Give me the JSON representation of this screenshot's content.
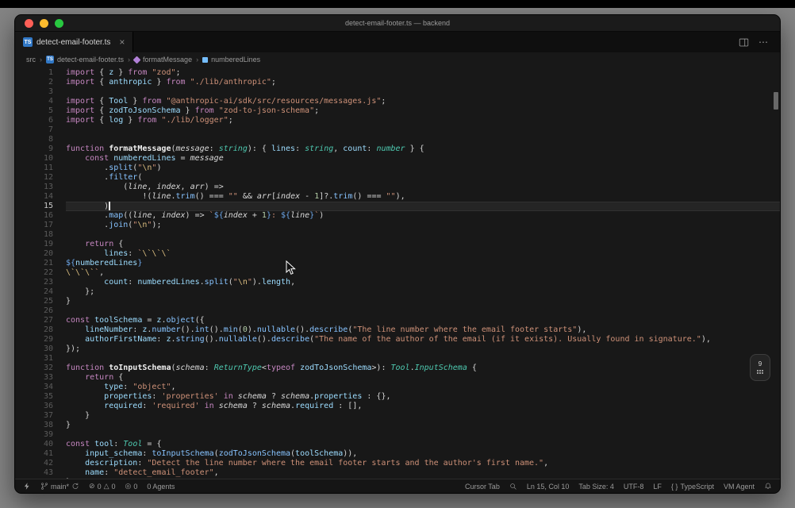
{
  "window": {
    "title": "detect-email-footer.ts — backend"
  },
  "colors": {
    "ts_icon": "#3178c6",
    "traffic_close": "#ff5f57",
    "traffic_minimize": "#febc2e",
    "traffic_zoom": "#28c840"
  },
  "tab": {
    "label": "detect-email-footer.ts",
    "file_icon": "TS",
    "close": "×"
  },
  "editor_actions": {
    "more": "⋯"
  },
  "breadcrumbs": {
    "separator": "›",
    "items": [
      {
        "label": "src"
      },
      {
        "label": "detect-email-footer.ts",
        "icon": "TS"
      },
      {
        "label": "formatMessage",
        "icon": "method"
      },
      {
        "label": "numberedLines",
        "icon": "field"
      }
    ]
  },
  "editor": {
    "active_line": 15,
    "cursor_line": 15,
    "cursor_col": 10
  },
  "floating_widget": {
    "badge": "9"
  },
  "status_bar": {
    "branch": "main*",
    "errors": "0",
    "warnings": "0",
    "error_glyph": "⊘",
    "warning_glyph": "△",
    "ports_glyph": "◎",
    "ports": "0",
    "agents": "0 Agents",
    "cursor_tab": "Cursor Tab",
    "position": "Ln 15, Col 10",
    "tab_size": "Tab Size: 4",
    "encoding": "UTF-8",
    "eol": "LF",
    "language_glyph": "{ }",
    "language": "TypeScript",
    "vm": "VM Agent"
  },
  "code": {
    "lines": [
      [
        [
          "k",
          "import"
        ],
        [
          "w",
          " { "
        ],
        [
          "v",
          "z"
        ],
        [
          "w",
          " } "
        ],
        [
          "k",
          "from"
        ],
        [
          "w",
          " "
        ],
        [
          "s",
          "\"zod\""
        ],
        [
          "w",
          ";"
        ]
      ],
      [
        [
          "k",
          "import"
        ],
        [
          "w",
          " { "
        ],
        [
          "v",
          "anthropic"
        ],
        [
          "w",
          " } "
        ],
        [
          "k",
          "from"
        ],
        [
          "w",
          " "
        ],
        [
          "s",
          "\"./lib/anthropic\""
        ],
        [
          "w",
          ";"
        ]
      ],
      [],
      [
        [
          "k",
          "import"
        ],
        [
          "w",
          " { "
        ],
        [
          "v",
          "Tool"
        ],
        [
          "w",
          " } "
        ],
        [
          "k",
          "from"
        ],
        [
          "w",
          " "
        ],
        [
          "s",
          "\"@anthropic-ai/sdk/src/resources/messages.js\""
        ],
        [
          "w",
          ";"
        ]
      ],
      [
        [
          "k",
          "import"
        ],
        [
          "w",
          " { "
        ],
        [
          "v",
          "zodToJsonSchema"
        ],
        [
          "w",
          " } "
        ],
        [
          "k",
          "from"
        ],
        [
          "w",
          " "
        ],
        [
          "s",
          "\"zod-to-json-schema\""
        ],
        [
          "w",
          ";"
        ]
      ],
      [
        [
          "k",
          "import"
        ],
        [
          "w",
          " { "
        ],
        [
          "v",
          "log"
        ],
        [
          "w",
          " } "
        ],
        [
          "k",
          "from"
        ],
        [
          "w",
          " "
        ],
        [
          "s",
          "\"./lib/logger\""
        ],
        [
          "w",
          ";"
        ]
      ],
      [],
      [],
      [
        [
          "k",
          "function"
        ],
        [
          "w",
          " "
        ],
        [
          "d",
          "formatMessage"
        ],
        [
          "w",
          "("
        ],
        [
          "p",
          "message"
        ],
        [
          "w",
          ": "
        ],
        [
          "t",
          "string"
        ],
        [
          "w",
          "): { "
        ],
        [
          "r",
          "lines"
        ],
        [
          "w",
          ": "
        ],
        [
          "t",
          "string"
        ],
        [
          "w",
          ", "
        ],
        [
          "r",
          "count"
        ],
        [
          "w",
          ": "
        ],
        [
          "t",
          "number"
        ],
        [
          "w",
          " } {"
        ]
      ],
      [
        [
          "w",
          "    "
        ],
        [
          "k",
          "const"
        ],
        [
          "w",
          " "
        ],
        [
          "v",
          "numberedLines"
        ],
        [
          "o",
          " = "
        ],
        [
          "p",
          "message"
        ]
      ],
      [
        [
          "w",
          "        ."
        ],
        [
          "f",
          "split"
        ],
        [
          "w",
          "("
        ],
        [
          "s",
          "\""
        ],
        [
          "e",
          "\\n"
        ],
        [
          "s",
          "\""
        ],
        [
          "w",
          ")"
        ]
      ],
      [
        [
          "w",
          "        ."
        ],
        [
          "f",
          "filter"
        ],
        [
          "w",
          "("
        ]
      ],
      [
        [
          "w",
          "            ("
        ],
        [
          "p",
          "line"
        ],
        [
          "w",
          ", "
        ],
        [
          "p",
          "index"
        ],
        [
          "w",
          ", "
        ],
        [
          "p",
          "arr"
        ],
        [
          "w",
          ") "
        ],
        [
          "o",
          "=>"
        ]
      ],
      [
        [
          "w",
          "                "
        ],
        [
          "o",
          "!"
        ],
        [
          "w",
          "("
        ],
        [
          "p",
          "line"
        ],
        [
          "w",
          "."
        ],
        [
          "f",
          "trim"
        ],
        [
          "w",
          "() "
        ],
        [
          "o",
          "==="
        ],
        [
          "w",
          " "
        ],
        [
          "s",
          "\"\""
        ],
        [
          "w",
          " "
        ],
        [
          "o",
          "&&"
        ],
        [
          "w",
          " "
        ],
        [
          "p",
          "arr"
        ],
        [
          "w",
          "["
        ],
        [
          "p",
          "index"
        ],
        [
          "o",
          " - "
        ],
        [
          "n",
          "1"
        ],
        [
          "w",
          "]"
        ],
        [
          "o",
          "?."
        ],
        [
          "f",
          "trim"
        ],
        [
          "w",
          "() "
        ],
        [
          "o",
          "==="
        ],
        [
          "w",
          " "
        ],
        [
          "s",
          "\"\""
        ],
        [
          "w",
          "),"
        ]
      ],
      [
        [
          "w",
          "        )"
        ]
      ],
      [
        [
          "w",
          "        ."
        ],
        [
          "f",
          "map"
        ],
        [
          "w",
          "(("
        ],
        [
          "p",
          "line"
        ],
        [
          "w",
          ", "
        ],
        [
          "p",
          "index"
        ],
        [
          "w",
          ") "
        ],
        [
          "o",
          "=>"
        ],
        [
          "w",
          " "
        ],
        [
          "s",
          "`"
        ],
        [
          "b",
          "${"
        ],
        [
          "p",
          "index"
        ],
        [
          "o",
          " + "
        ],
        [
          "n",
          "1"
        ],
        [
          "b",
          "}"
        ],
        [
          "s",
          ": "
        ],
        [
          "b",
          "${"
        ],
        [
          "p",
          "line"
        ],
        [
          "b",
          "}"
        ],
        [
          "s",
          "`"
        ],
        [
          "w",
          ")"
        ]
      ],
      [
        [
          "w",
          "        ."
        ],
        [
          "f",
          "join"
        ],
        [
          "w",
          "("
        ],
        [
          "s",
          "\""
        ],
        [
          "e",
          "\\n"
        ],
        [
          "s",
          "\""
        ],
        [
          "w",
          ");"
        ]
      ],
      [],
      [
        [
          "w",
          "    "
        ],
        [
          "k",
          "return"
        ],
        [
          "w",
          " {"
        ]
      ],
      [
        [
          "w",
          "        "
        ],
        [
          "r",
          "lines"
        ],
        [
          "w",
          ": "
        ],
        [
          "s",
          "`"
        ],
        [
          "e",
          "\\`"
        ],
        [
          "e",
          "\\`"
        ],
        [
          "e",
          "\\`"
        ]
      ],
      [
        [
          "b",
          "${"
        ],
        [
          "v",
          "numberedLines"
        ],
        [
          "b",
          "}"
        ]
      ],
      [
        [
          "e",
          "\\`"
        ],
        [
          "e",
          "\\`"
        ],
        [
          "e",
          "\\`"
        ],
        [
          "s",
          "`"
        ],
        [
          "w",
          ","
        ]
      ],
      [
        [
          "w",
          "        "
        ],
        [
          "r",
          "count"
        ],
        [
          "w",
          ": "
        ],
        [
          "v",
          "numberedLines"
        ],
        [
          "w",
          "."
        ],
        [
          "f",
          "split"
        ],
        [
          "w",
          "("
        ],
        [
          "s",
          "\""
        ],
        [
          "e",
          "\\n"
        ],
        [
          "s",
          "\""
        ],
        [
          "w",
          ")."
        ],
        [
          "r",
          "length"
        ],
        [
          "w",
          ","
        ]
      ],
      [
        [
          "w",
          "    };"
        ]
      ],
      [
        [
          "w",
          "}"
        ]
      ],
      [],
      [
        [
          "k",
          "const"
        ],
        [
          "w",
          " "
        ],
        [
          "v",
          "toolSchema"
        ],
        [
          "o",
          " = "
        ],
        [
          "v",
          "z"
        ],
        [
          "w",
          "."
        ],
        [
          "f",
          "object"
        ],
        [
          "w",
          "({"
        ]
      ],
      [
        [
          "w",
          "    "
        ],
        [
          "r",
          "lineNumber"
        ],
        [
          "w",
          ": "
        ],
        [
          "v",
          "z"
        ],
        [
          "w",
          "."
        ],
        [
          "f",
          "number"
        ],
        [
          "w",
          "()."
        ],
        [
          "f",
          "int"
        ],
        [
          "w",
          "()."
        ],
        [
          "f",
          "min"
        ],
        [
          "w",
          "("
        ],
        [
          "n",
          "0"
        ],
        [
          "w",
          ")."
        ],
        [
          "f",
          "nullable"
        ],
        [
          "w",
          "()."
        ],
        [
          "f",
          "describe"
        ],
        [
          "w",
          "("
        ],
        [
          "s",
          "\"The line number where the email footer starts\""
        ],
        [
          "w",
          "),"
        ]
      ],
      [
        [
          "w",
          "    "
        ],
        [
          "r",
          "authorFirstName"
        ],
        [
          "w",
          ": "
        ],
        [
          "v",
          "z"
        ],
        [
          "w",
          "."
        ],
        [
          "f",
          "string"
        ],
        [
          "w",
          "()."
        ],
        [
          "f",
          "nullable"
        ],
        [
          "w",
          "()."
        ],
        [
          "f",
          "describe"
        ],
        [
          "w",
          "("
        ],
        [
          "s",
          "\"The name of the author of the email (if it exists). Usually found in signature.\""
        ],
        [
          "w",
          "),"
        ]
      ],
      [
        [
          "w",
          "});"
        ]
      ],
      [],
      [
        [
          "k",
          "function"
        ],
        [
          "w",
          " "
        ],
        [
          "d",
          "toInputSchema"
        ],
        [
          "w",
          "("
        ],
        [
          "p",
          "schema"
        ],
        [
          "w",
          ": "
        ],
        [
          "t",
          "ReturnType"
        ],
        [
          "w",
          "<"
        ],
        [
          "k",
          "typeof"
        ],
        [
          "w",
          " "
        ],
        [
          "v",
          "zodToJsonSchema"
        ],
        [
          "w",
          ">): "
        ],
        [
          "t",
          "Tool"
        ],
        [
          "w",
          "."
        ],
        [
          "t",
          "InputSchema"
        ],
        [
          "w",
          " {"
        ]
      ],
      [
        [
          "w",
          "    "
        ],
        [
          "k",
          "return"
        ],
        [
          "w",
          " {"
        ]
      ],
      [
        [
          "w",
          "        "
        ],
        [
          "r",
          "type"
        ],
        [
          "w",
          ": "
        ],
        [
          "s",
          "\"object\""
        ],
        [
          "w",
          ","
        ]
      ],
      [
        [
          "w",
          "        "
        ],
        [
          "r",
          "properties"
        ],
        [
          "w",
          ": "
        ],
        [
          "s",
          "'properties'"
        ],
        [
          "w",
          " "
        ],
        [
          "k",
          "in"
        ],
        [
          "w",
          " "
        ],
        [
          "p",
          "schema"
        ],
        [
          "o",
          " ? "
        ],
        [
          "p",
          "schema"
        ],
        [
          "w",
          "."
        ],
        [
          "r",
          "properties"
        ],
        [
          "o",
          " : "
        ],
        [
          "w",
          "{},"
        ]
      ],
      [
        [
          "w",
          "        "
        ],
        [
          "r",
          "required"
        ],
        [
          "w",
          ": "
        ],
        [
          "s",
          "'required'"
        ],
        [
          "w",
          " "
        ],
        [
          "k",
          "in"
        ],
        [
          "w",
          " "
        ],
        [
          "p",
          "schema"
        ],
        [
          "o",
          " ? "
        ],
        [
          "p",
          "schema"
        ],
        [
          "w",
          "."
        ],
        [
          "r",
          "required"
        ],
        [
          "o",
          " : "
        ],
        [
          "w",
          "[],"
        ]
      ],
      [
        [
          "w",
          "    }"
        ]
      ],
      [
        [
          "w",
          "}"
        ]
      ],
      [],
      [
        [
          "k",
          "const"
        ],
        [
          "w",
          " "
        ],
        [
          "v",
          "tool"
        ],
        [
          "w",
          ": "
        ],
        [
          "t",
          "Tool"
        ],
        [
          "o",
          " = "
        ],
        [
          "w",
          "{"
        ]
      ],
      [
        [
          "w",
          "    "
        ],
        [
          "r",
          "input_schema"
        ],
        [
          "w",
          ": "
        ],
        [
          "f",
          "toInputSchema"
        ],
        [
          "w",
          "("
        ],
        [
          "f",
          "zodToJsonSchema"
        ],
        [
          "w",
          "("
        ],
        [
          "v",
          "toolSchema"
        ],
        [
          "w",
          ")),"
        ]
      ],
      [
        [
          "w",
          "    "
        ],
        [
          "r",
          "description"
        ],
        [
          "w",
          ": "
        ],
        [
          "s",
          "\"Detect the line number where the email footer starts and the author's first name.\""
        ],
        [
          "w",
          ","
        ]
      ],
      [
        [
          "w",
          "    "
        ],
        [
          "r",
          "name"
        ],
        [
          "w",
          ": "
        ],
        [
          "s",
          "\"detect_email_footer\""
        ],
        [
          "w",
          ","
        ]
      ],
      [
        [
          "w",
          "};"
        ]
      ]
    ]
  }
}
